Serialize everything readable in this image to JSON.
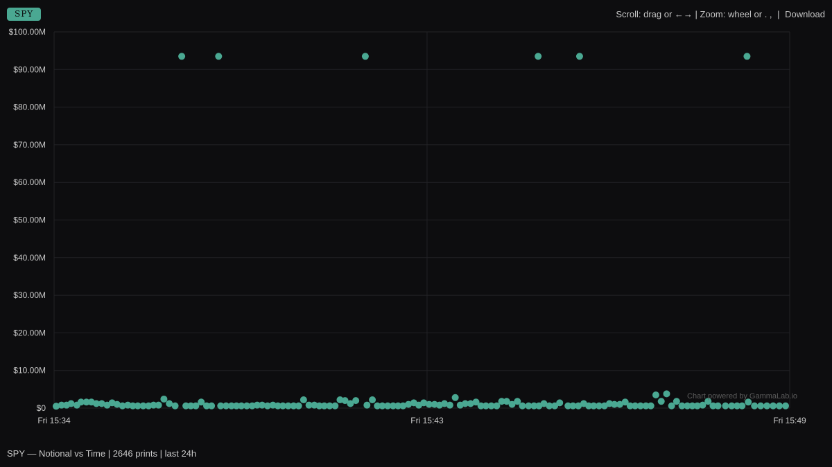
{
  "ticker": "SPY",
  "toolbar": {
    "hint": "Scroll: drag or ←→ | Zoom: wheel or . ,",
    "separator": "|",
    "download_label": "Download"
  },
  "watermark": "Chart powered by GammaLab.io",
  "footer": "SPY — Notional vs Time | 2646 prints | last 24h",
  "colors": {
    "background": "#0d0d0f",
    "grid": "#222226",
    "point": "#4aa892",
    "text": "#c9c9c9"
  },
  "chart_data": {
    "type": "scatter",
    "title": "",
    "xlabel": "",
    "ylabel": "",
    "grid": true,
    "legend": "none",
    "x_unit": "minutes since 15:34",
    "x_ticks": [
      {
        "x": 0,
        "label": "Fri 15:34"
      },
      {
        "x": 9,
        "label": "Fri 15:43"
      },
      {
        "x": 17.75,
        "label": "Fri 15:49"
      }
    ],
    "xlim": [
      0,
      17.75
    ],
    "y_ticks": [
      {
        "y": 0,
        "label": "$0"
      },
      {
        "y": 10,
        "label": "$10.00M"
      },
      {
        "y": 20,
        "label": "$20.00M"
      },
      {
        "y": 30,
        "label": "$30.00M"
      },
      {
        "y": 40,
        "label": "$40.00M"
      },
      {
        "y": 50,
        "label": "$50.00M"
      },
      {
        "y": 60,
        "label": "$60.00M"
      },
      {
        "y": 70,
        "label": "$70.00M"
      },
      {
        "y": 80,
        "label": "$80.00M"
      },
      {
        "y": 90,
        "label": "$90.00M"
      },
      {
        "y": 100,
        "label": "$100.00M"
      }
    ],
    "ylim": [
      0,
      100
    ],
    "y_unit": "$M notional",
    "points": [
      [
        0.05,
        0.5
      ],
      [
        0.18,
        0.8
      ],
      [
        0.3,
        0.8
      ],
      [
        0.41,
        1.2
      ],
      [
        0.55,
        0.8
      ],
      [
        0.65,
        1.6
      ],
      [
        0.78,
        1.6
      ],
      [
        0.9,
        1.6
      ],
      [
        1.02,
        1.2
      ],
      [
        1.15,
        1.2
      ],
      [
        1.28,
        0.8
      ],
      [
        1.4,
        1.4
      ],
      [
        1.52,
        1.0
      ],
      [
        1.65,
        0.6
      ],
      [
        1.78,
        0.8
      ],
      [
        1.9,
        0.6
      ],
      [
        2.02,
        0.6
      ],
      [
        2.15,
        0.6
      ],
      [
        2.28,
        0.6
      ],
      [
        2.4,
        0.8
      ],
      [
        2.52,
        0.8
      ],
      [
        2.65,
        2.4
      ],
      [
        2.78,
        1.2
      ],
      [
        2.92,
        0.6
      ],
      [
        3.08,
        93.5
      ],
      [
        3.18,
        0.6
      ],
      [
        3.3,
        0.6
      ],
      [
        3.42,
        0.6
      ],
      [
        3.55,
        1.6
      ],
      [
        3.68,
        0.6
      ],
      [
        3.8,
        0.6
      ],
      [
        3.97,
        93.5
      ],
      [
        4.02,
        0.6
      ],
      [
        4.15,
        0.6
      ],
      [
        4.28,
        0.6
      ],
      [
        4.4,
        0.6
      ],
      [
        4.52,
        0.6
      ],
      [
        4.65,
        0.6
      ],
      [
        4.78,
        0.6
      ],
      [
        4.9,
        0.8
      ],
      [
        5.02,
        0.8
      ],
      [
        5.15,
        0.6
      ],
      [
        5.28,
        0.8
      ],
      [
        5.4,
        0.6
      ],
      [
        5.52,
        0.6
      ],
      [
        5.65,
        0.6
      ],
      [
        5.78,
        0.6
      ],
      [
        5.9,
        0.6
      ],
      [
        6.02,
        2.2
      ],
      [
        6.15,
        0.8
      ],
      [
        6.28,
        0.8
      ],
      [
        6.4,
        0.6
      ],
      [
        6.52,
        0.6
      ],
      [
        6.65,
        0.6
      ],
      [
        6.78,
        0.6
      ],
      [
        6.9,
        2.2
      ],
      [
        7.02,
        2.0
      ],
      [
        7.15,
        1.2
      ],
      [
        7.28,
        2.0
      ],
      [
        7.51,
        93.5
      ],
      [
        7.55,
        0.8
      ],
      [
        7.68,
        2.2
      ],
      [
        7.8,
        0.6
      ],
      [
        7.92,
        0.6
      ],
      [
        8.05,
        0.6
      ],
      [
        8.18,
        0.6
      ],
      [
        8.3,
        0.6
      ],
      [
        8.42,
        0.6
      ],
      [
        8.55,
        1.0
      ],
      [
        8.68,
        1.4
      ],
      [
        8.8,
        0.8
      ],
      [
        8.92,
        1.4
      ],
      [
        9.05,
        1.0
      ],
      [
        9.18,
        1.0
      ],
      [
        9.3,
        0.8
      ],
      [
        9.42,
        1.2
      ],
      [
        9.55,
        0.8
      ],
      [
        9.68,
        2.8
      ],
      [
        9.8,
        0.8
      ],
      [
        9.92,
        1.2
      ],
      [
        10.05,
        1.2
      ],
      [
        10.18,
        1.6
      ],
      [
        10.3,
        0.6
      ],
      [
        10.42,
        0.6
      ],
      [
        10.55,
        0.6
      ],
      [
        10.68,
        0.6
      ],
      [
        10.8,
        1.8
      ],
      [
        10.92,
        1.8
      ],
      [
        11.05,
        1.0
      ],
      [
        11.18,
        1.8
      ],
      [
        11.3,
        0.6
      ],
      [
        11.68,
        93.5
      ],
      [
        11.45,
        0.6
      ],
      [
        11.58,
        0.6
      ],
      [
        11.7,
        0.6
      ],
      [
        11.82,
        1.2
      ],
      [
        11.95,
        0.6
      ],
      [
        12.08,
        0.6
      ],
      [
        12.2,
        1.4
      ],
      [
        12.68,
        93.5
      ],
      [
        12.4,
        0.6
      ],
      [
        12.52,
        0.6
      ],
      [
        12.65,
        0.6
      ],
      [
        12.78,
        1.2
      ],
      [
        12.9,
        0.6
      ],
      [
        13.02,
        0.6
      ],
      [
        13.15,
        0.6
      ],
      [
        13.28,
        0.6
      ],
      [
        13.4,
        1.2
      ],
      [
        13.52,
        1.0
      ],
      [
        13.65,
        1.0
      ],
      [
        13.78,
        1.6
      ],
      [
        13.9,
        0.6
      ],
      [
        14.02,
        0.6
      ],
      [
        14.15,
        0.6
      ],
      [
        14.28,
        0.6
      ],
      [
        14.4,
        0.6
      ],
      [
        14.52,
        3.5
      ],
      [
        14.65,
        1.8
      ],
      [
        14.78,
        3.8
      ],
      [
        14.9,
        0.6
      ],
      [
        15.02,
        1.8
      ],
      [
        15.15,
        0.6
      ],
      [
        15.28,
        0.6
      ],
      [
        15.4,
        0.6
      ],
      [
        15.52,
        0.6
      ],
      [
        15.65,
        0.8
      ],
      [
        15.78,
        1.8
      ],
      [
        15.9,
        0.6
      ],
      [
        16.02,
        0.6
      ],
      [
        16.72,
        93.5
      ],
      [
        16.2,
        0.6
      ],
      [
        16.35,
        0.6
      ],
      [
        16.48,
        0.6
      ],
      [
        16.6,
        0.6
      ],
      [
        16.75,
        1.6
      ],
      [
        16.9,
        0.6
      ],
      [
        17.05,
        0.6
      ],
      [
        17.2,
        0.6
      ],
      [
        17.35,
        0.6
      ],
      [
        17.5,
        0.6
      ],
      [
        17.65,
        0.6
      ]
    ]
  }
}
